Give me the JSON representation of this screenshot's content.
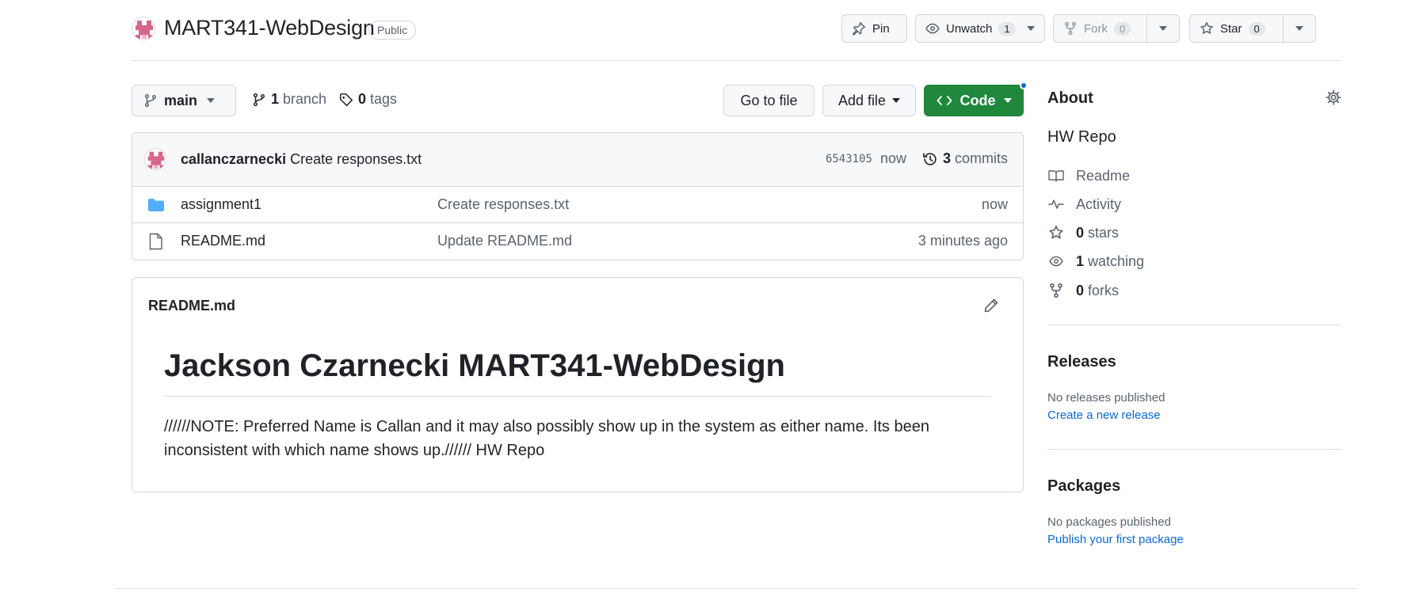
{
  "repo": {
    "name": "MART341-WebDesign",
    "visibility": "Public"
  },
  "header_actions": {
    "pin": "Pin",
    "unwatch": "Unwatch",
    "unwatch_count": "1",
    "fork": "Fork",
    "fork_count": "0",
    "star": "Star",
    "star_count": "0"
  },
  "toolbar": {
    "branch": "main",
    "branch_count": "1",
    "branch_label": "branch",
    "tag_count": "0",
    "tag_label": "tags",
    "go_to_file": "Go to file",
    "add_file": "Add file",
    "code": "Code"
  },
  "commit": {
    "author": "callanczarnecki",
    "message": "Create responses.txt",
    "sha": "6543105",
    "time": "now",
    "commit_count": "3",
    "commit_label": "commits"
  },
  "files": [
    {
      "name": "assignment1",
      "type": "folder",
      "message": "Create responses.txt",
      "time": "now"
    },
    {
      "name": "README.md",
      "type": "file",
      "message": "Update README.md",
      "time": "3 minutes ago"
    }
  ],
  "readme": {
    "filename": "README.md",
    "heading": "Jackson Czarnecki MART341-WebDesign",
    "body": "//////NOTE: Preferred Name is Callan and it may also possibly show up in the system as either name. Its been inconsistent with which name shows up.////// HW Repo"
  },
  "about": {
    "title": "About",
    "description": "HW Repo",
    "readme": "Readme",
    "activity": "Activity",
    "stars_count": "0",
    "stars_label": "stars",
    "watching_count": "1",
    "watching_label": "watching",
    "forks_count": "0",
    "forks_label": "forks"
  },
  "releases": {
    "title": "Releases",
    "none": "No releases published",
    "link": "Create a new release"
  },
  "packages": {
    "title": "Packages",
    "none": "No packages published",
    "link": "Publish your first package"
  },
  "colors": {
    "accent_green": "#1f883d",
    "link_blue": "#0969da",
    "folder_blue": "#54aeff",
    "avatar_pink": "#d4678a"
  }
}
